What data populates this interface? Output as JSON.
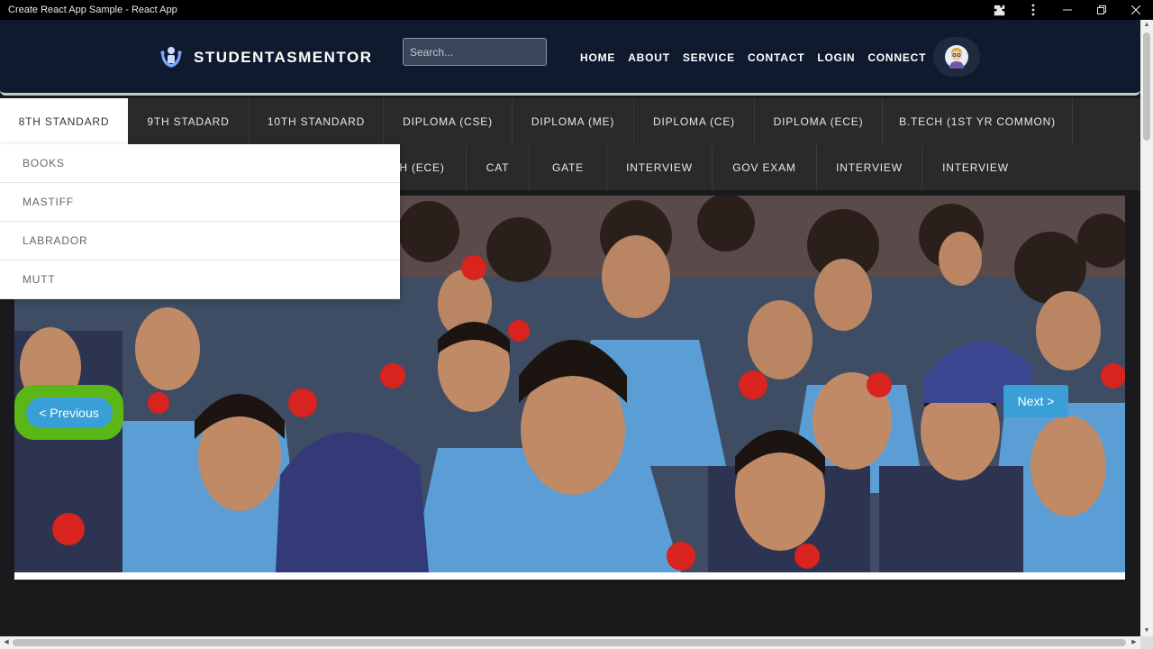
{
  "window": {
    "title": "Create React App Sample - React App",
    "controls": [
      "extensions-icon",
      "more-icon",
      "minimize-icon",
      "maximize-icon",
      "close-icon"
    ]
  },
  "header": {
    "brand": "STUDENTASMENTOR",
    "search_placeholder": "Search...",
    "nav": [
      "HOME",
      "ABOUT",
      "SERVICE",
      "CONTACT",
      "LOGIN",
      "CONNECT"
    ],
    "avatar_icon": "user-avatar-icon"
  },
  "categories": {
    "row1": [
      "8TH STANDARD",
      "9TH STADARD",
      "10TH STANDARD",
      "DIPLOMA (CSE)",
      "DIPLOMA (ME)",
      "DIPLOMA (CE)",
      "DIPLOMA (ECE)",
      "B.TECH (1ST YR COMMON)"
    ],
    "row2": [
      "H (ECE)",
      "CAT",
      "GATE",
      "INTERVIEW",
      "GOV EXAM",
      "INTERVIEW",
      "INTERVIEW"
    ],
    "active": "8TH STANDARD"
  },
  "dropdown": {
    "items": [
      "BOOKS",
      "MASTIFF",
      "LABRADOR",
      "MUTT"
    ]
  },
  "carousel": {
    "image_desc": "students-photo",
    "prev_label": "< Previous",
    "next_label": "Next >"
  },
  "colors": {
    "header_bg": "#0f1a2e",
    "catbar_bg": "#2a2a2a",
    "button_blue": "#3a9fd6",
    "highlight_green": "#5bb618"
  }
}
